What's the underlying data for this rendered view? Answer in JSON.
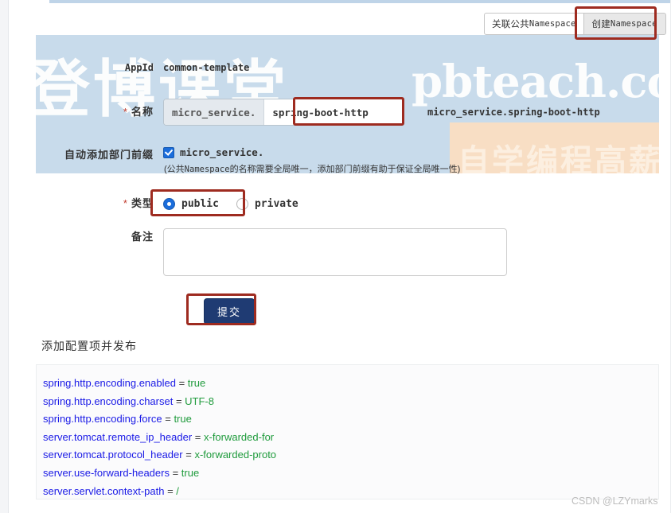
{
  "top_actions": {
    "associate_public_namespace": {
      "cn": "关联公共",
      "mono": "Namespace"
    },
    "create_namespace": {
      "cn": "创建",
      "mono": "Namespace"
    }
  },
  "form": {
    "appid": {
      "label": "AppId",
      "value": "common-template"
    },
    "name": {
      "label": "名称",
      "required_marker": "*",
      "prefix_addon": "micro_service.",
      "input_value": "spring-boot-http",
      "preview": "micro_service.spring-boot-http"
    },
    "auto_prefix": {
      "label": "自动添加部门前缀",
      "checkbox_checked": true,
      "checkbox_label": "micro_service.",
      "hint_prefix": "(公共",
      "hint_mono": "Namespace",
      "hint_suffix": "的名称需要全局唯一，添加部门前缀有助于保证全局唯一性)"
    },
    "type": {
      "label": "类型",
      "required_marker": "*",
      "options": [
        {
          "value": "public",
          "label": "public",
          "selected": true
        },
        {
          "value": "private",
          "label": "private",
          "selected": false
        }
      ]
    },
    "remark": {
      "label": "备注",
      "value": "",
      "placeholder": ""
    },
    "submit_label": "提交"
  },
  "section": {
    "heading": "添加配置项并发布"
  },
  "config": {
    "lines": [
      {
        "key": "spring.http.encoding.enabled",
        "eq": "=",
        "value": "true"
      },
      {
        "key": "spring.http.encoding.charset",
        "eq": "=",
        "value": "UTF-8"
      },
      {
        "key": "spring.http.encoding.force",
        "eq": "=",
        "value": "true"
      },
      {
        "key": "server.tomcat.remote_ip_header",
        "eq": "=",
        "value": "x-forwarded-for"
      },
      {
        "key": "server.tomcat.protocol_header",
        "eq": "=",
        "value": "x-forwarded-proto"
      },
      {
        "key": "server.use-forward-headers",
        "eq": "=",
        "value": "true"
      },
      {
        "key": "server.servlet.context-path",
        "eq": "=",
        "value": "/"
      }
    ]
  },
  "watermarks": {
    "background_cn_left": "登博课堂",
    "background_latin": "pbteach.co",
    "background_cn_right": "自学编程高薪就",
    "footer": "CSDN @LZYmarks"
  },
  "colors": {
    "panel_blue": "#c8dbeb",
    "accent_blue": "#1b6ddb",
    "submit_navy": "#1f3b73",
    "annotation_red": "#9e2b20",
    "config_key": "#1a1ae6",
    "config_value": "#1f9b3c"
  }
}
